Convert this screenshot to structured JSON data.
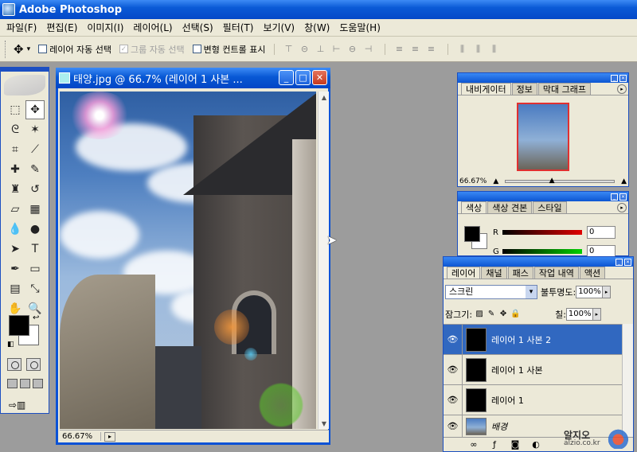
{
  "app": {
    "title": "Adobe Photoshop"
  },
  "menu": [
    "파일(F)",
    "편집(E)",
    "이미지(I)",
    "레이어(L)",
    "선택(S)",
    "필터(T)",
    "보기(V)",
    "창(W)",
    "도움말(H)"
  ],
  "options": {
    "auto_select_layer": "레이어 자동 선택",
    "auto_select_group": "그룹 자동 선택",
    "show_transform": "변형 컨트롤 표시"
  },
  "document": {
    "title": "태양.jpg @ 66.7% (레이어 1 사본 ...",
    "zoom": "66.67%"
  },
  "navigator": {
    "tabs": [
      "내비게이터",
      "정보",
      "막대 그래프"
    ],
    "zoom": "66.67%"
  },
  "color": {
    "tabs": [
      "색상",
      "색상 견본",
      "스타일"
    ],
    "r_label": "R",
    "r_value": "0",
    "g_label": "G",
    "g_value": "0"
  },
  "layers": {
    "tabs": [
      "레이어",
      "채널",
      "패스",
      "작업 내역",
      "액션"
    ],
    "blend_mode": "스크린",
    "opacity_label": "불투명도:",
    "opacity": "100%",
    "lock_label": "잠그기:",
    "fill_label": "칠:",
    "fill": "100%",
    "items": [
      {
        "name": "레이어 1 사본 2",
        "selected": true
      },
      {
        "name": "레이어 1 사본",
        "selected": false
      },
      {
        "name": "레이어 1",
        "selected": false
      },
      {
        "name": "배경",
        "selected": false
      }
    ]
  },
  "watermark": {
    "text": "알지오",
    "url": "alzio.co.kr"
  },
  "colors": {
    "titlebar": "#0a5ad6",
    "selection": "#3168c0",
    "chrome": "#ece9d8"
  }
}
